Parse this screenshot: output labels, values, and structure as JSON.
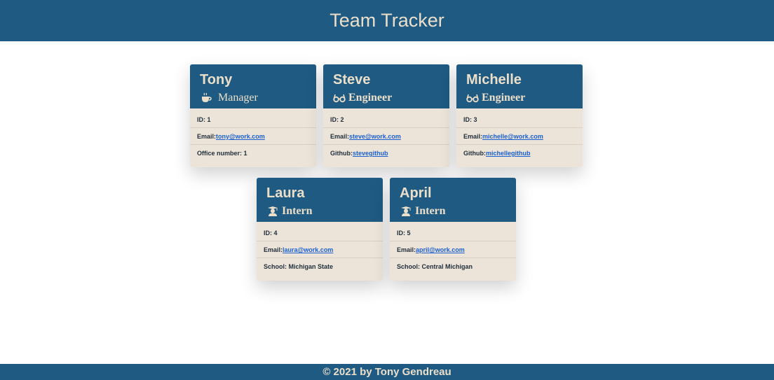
{
  "header": {
    "title": "Team Tracker"
  },
  "footer": {
    "text": "© 2021 by Tony Gendreau"
  },
  "colors": {
    "primary": "#1e5a82",
    "cream": "#ecdfca",
    "card_bg": "#ece4d9",
    "link": "#1a5fd0"
  },
  "cards": [
    {
      "name": "Tony",
      "role": "Manager",
      "icon": "coffee-icon",
      "id_text": "ID: 1",
      "email_label": "Email:",
      "email": "tony@work.com",
      "extra_text": "Office number: 1"
    },
    {
      "name": "Steve",
      "role": "Engineer",
      "icon": "glasses-icon",
      "id_text": "ID: 2",
      "email_label": "Email:",
      "email": "steve@work.com",
      "github_label": "Github:",
      "github": "stevegithub"
    },
    {
      "name": "Michelle",
      "role": "Engineer",
      "icon": "glasses-icon",
      "id_text": "ID: 3",
      "email_label": "Email:",
      "email": "michelle@work.com",
      "github_label": "Github:",
      "github": "michellegithub"
    },
    {
      "name": "Laura",
      "role": "Intern",
      "icon": "graduate-icon",
      "id_text": "ID: 4",
      "email_label": "Email:",
      "email": "laura@work.com",
      "extra_text": "School: Michigan State"
    },
    {
      "name": "April",
      "role": "Intern",
      "icon": "graduate-icon",
      "id_text": "ID: 5",
      "email_label": "Email:",
      "email": "april@work.com",
      "extra_text": "School: Central Michigan"
    }
  ]
}
